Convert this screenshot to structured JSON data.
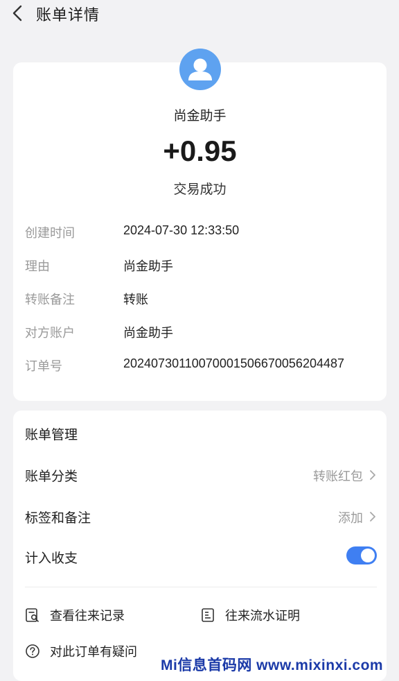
{
  "header": {
    "title": "账单详情",
    "back_icon": "chevron-left-icon"
  },
  "transaction": {
    "avatar_icon": "user-avatar-icon",
    "payee": "尚金助手",
    "amount": "+0.95",
    "status": "交易成功"
  },
  "details": [
    {
      "label": "创建时间",
      "value": "2024-07-30 12:33:50"
    },
    {
      "label": "理由",
      "value": "尚金助手"
    },
    {
      "label": "转账备注",
      "value": "转账"
    },
    {
      "label": "对方账户",
      "value": "尚金助手"
    },
    {
      "label": "订单号",
      "value": "20240730110070001506670056204487"
    }
  ],
  "manage": {
    "title": "账单管理",
    "category": {
      "label": "账单分类",
      "value": "转账红包"
    },
    "tags": {
      "label": "标签和备注",
      "value": "添加"
    },
    "income_expense": {
      "label": "计入收支",
      "enabled": true
    },
    "actions": {
      "history": {
        "label": "查看往来记录",
        "icon": "search-record-icon"
      },
      "statement": {
        "label": "往来流水证明",
        "icon": "document-icon"
      },
      "question": {
        "label": "对此订单有疑问",
        "icon": "question-circle-icon"
      }
    }
  },
  "colors": {
    "background": "#f2f2f4",
    "card": "#ffffff",
    "accent": "#3f7ff2",
    "avatar": "#5ea2f0",
    "muted_text": "#9a9a9a"
  },
  "watermark": "Mi信息首码网 www.mixinxi.com"
}
